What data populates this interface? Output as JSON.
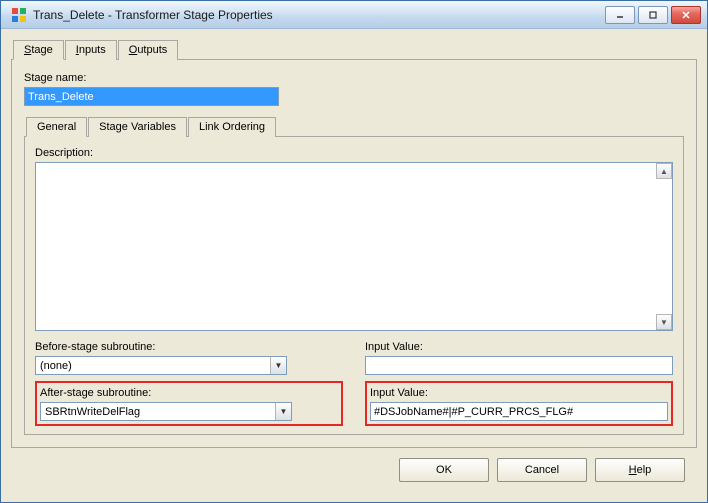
{
  "window": {
    "title": "Trans_Delete - Transformer Stage Properties"
  },
  "tabs": {
    "stage_prefix": "S",
    "stage_rest": "tage",
    "inputs_prefix": "I",
    "inputs_rest": "nputs",
    "outputs_prefix": "O",
    "outputs_rest": "utputs"
  },
  "stage": {
    "name_label": "Stage name:",
    "name_value": "Trans_Delete"
  },
  "inner_tabs": {
    "general": "General",
    "stage_vars": "Stage Variables",
    "link_ordering": "Link Ordering"
  },
  "general": {
    "description_label": "Description:",
    "before_sub_label": "Before-stage subroutine:",
    "before_sub_value": "(none)",
    "before_input_label": "Input Value:",
    "before_input_value": "",
    "after_sub_label": "After-stage subroutine:",
    "after_sub_value": "SBRtnWriteDelFlag",
    "after_input_label": "Input Value:",
    "after_input_value": "#DSJobName#|#P_CURR_PRCS_FLG#"
  },
  "buttons": {
    "ok": "OK",
    "cancel": "Cancel",
    "help_prefix": "H",
    "help_rest": "elp"
  }
}
